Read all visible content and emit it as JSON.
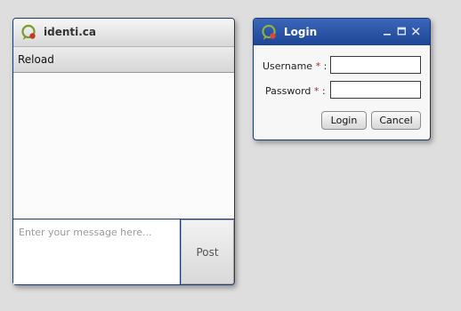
{
  "main_window": {
    "title": "identi.ca",
    "logo": "identica-logo",
    "toolbar": {
      "reload_label": "Reload"
    },
    "composer": {
      "placeholder": "Enter your message here...",
      "value": ""
    },
    "post_label": "Post"
  },
  "login_dialog": {
    "title": "Login",
    "controls": [
      "minimize-icon",
      "maximize-icon",
      "close-icon"
    ],
    "fields": [
      {
        "label": "Username",
        "required_marker": "*",
        "colon": ":",
        "value": ""
      },
      {
        "label": "Password",
        "required_marker": "*",
        "colon": ":",
        "value": ""
      }
    ],
    "login_label": "Login",
    "cancel_label": "Cancel"
  },
  "colors": {
    "desktop": "#dedede",
    "window_border": "#1f3b6e",
    "dialog_titlebar": "#2a54a8",
    "required_marker": "#cc2222"
  }
}
